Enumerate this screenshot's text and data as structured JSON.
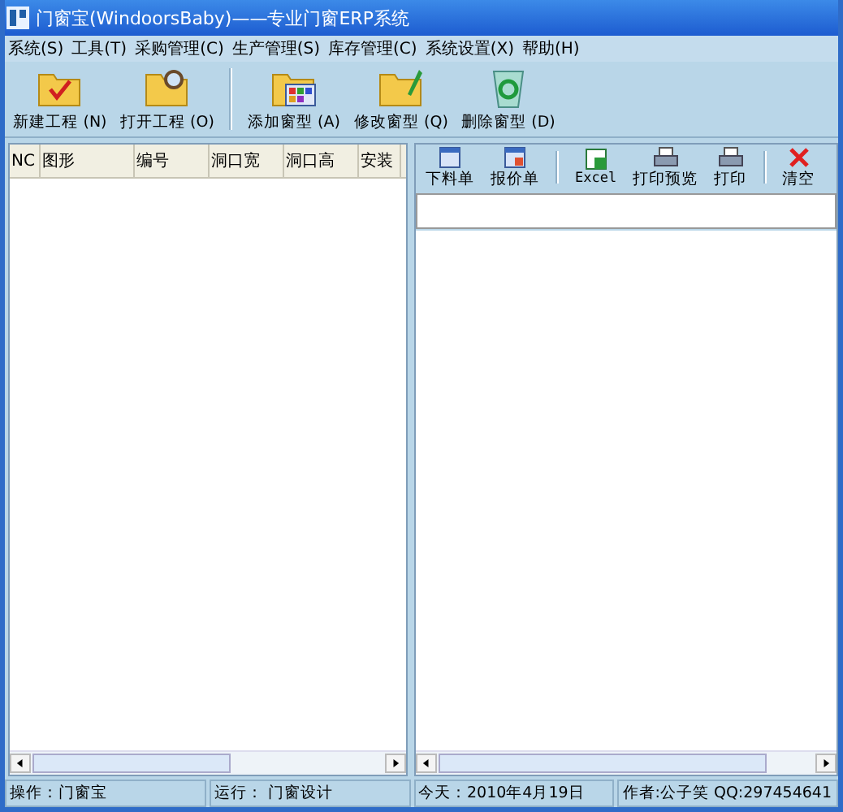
{
  "window": {
    "title": "门窗宝(WindoorsBaby)——专业门窗ERP系统"
  },
  "menu": [
    "系统(S)",
    "工具(T)",
    "采购管理(C)",
    "生产管理(S)",
    "库存管理(C)",
    "系统设置(X)",
    "帮助(H)"
  ],
  "toolbar": [
    [
      {
        "label": "新建工程 (N)",
        "kind": "new"
      },
      {
        "label": "打开工程 (O)",
        "kind": "open"
      }
    ],
    [
      {
        "label": "添加窗型 (A)",
        "kind": "add"
      },
      {
        "label": "修改窗型 (Q)",
        "kind": "edit"
      },
      {
        "label": "删除窗型 (D)",
        "kind": "delete"
      }
    ]
  ],
  "table": {
    "columns": [
      "NC",
      "图形",
      "编号",
      "洞口宽",
      "洞口高",
      "安装"
    ]
  },
  "report_toolbar": [
    [
      {
        "label": "下料单",
        "kind": "cut"
      },
      {
        "label": "报价单",
        "kind": "quote"
      }
    ],
    [
      {
        "label": "Excel",
        "kind": "excel"
      },
      {
        "label": "打印预览",
        "kind": "preview"
      },
      {
        "label": "打印",
        "kind": "print"
      }
    ],
    [
      {
        "label": "清空",
        "kind": "clear"
      }
    ]
  ],
  "status_bar": [
    "操作：门窗宝",
    "运行： 门窗设计",
    "今天：2010年4月19日",
    "作者:公子笑 QQ:297454641"
  ]
}
